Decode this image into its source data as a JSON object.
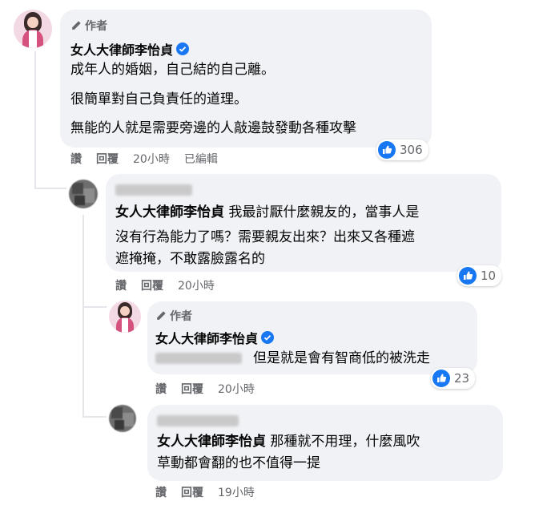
{
  "comment1": {
    "author_tag": "作者",
    "name": "女人大律師李怡貞",
    "lines": [
      "成年人的婚姻，自己結的自己離。",
      "很簡單對自己負責任的道理。",
      "無能的人就是需要旁邊的人敲邊鼓發動各種攻擊"
    ],
    "reaction_count": "306",
    "actions": {
      "like": "讚",
      "reply": "回覆",
      "time": "20小時",
      "edited": "已編輯"
    }
  },
  "reply1": {
    "mention": "女人大律師李怡貞",
    "line1": "我最討厭什麼親友的，當事人是",
    "line2": "沒有行為能力了嗎？需要親友出來？出來又各種遮",
    "line3": "遮掩掩，不敢露臉露名的",
    "reaction_count": "10",
    "actions": {
      "like": "讚",
      "reply": "回覆",
      "time": "20小時"
    }
  },
  "reply2": {
    "author_tag": "作者",
    "name": "女人大律師李怡貞",
    "text": "但是就是會有智商低的被洗走",
    "reaction_count": "23",
    "actions": {
      "like": "讚",
      "reply": "回覆",
      "time": "20小時"
    }
  },
  "reply3": {
    "mention": "女人大律師李怡貞",
    "line1": "那種就不用理，什麼風吹",
    "line2": "草動都會翻的也不值得一提",
    "actions": {
      "like": "讚",
      "reply": "回覆",
      "time": "19小時"
    }
  },
  "colors": {
    "like_blue": "#1877f2",
    "bubble": "#f0f2f5",
    "meta_gray": "#65676b"
  },
  "icons": [
    "pencil-icon",
    "verified-badge-icon",
    "like-reaction-icon"
  ]
}
